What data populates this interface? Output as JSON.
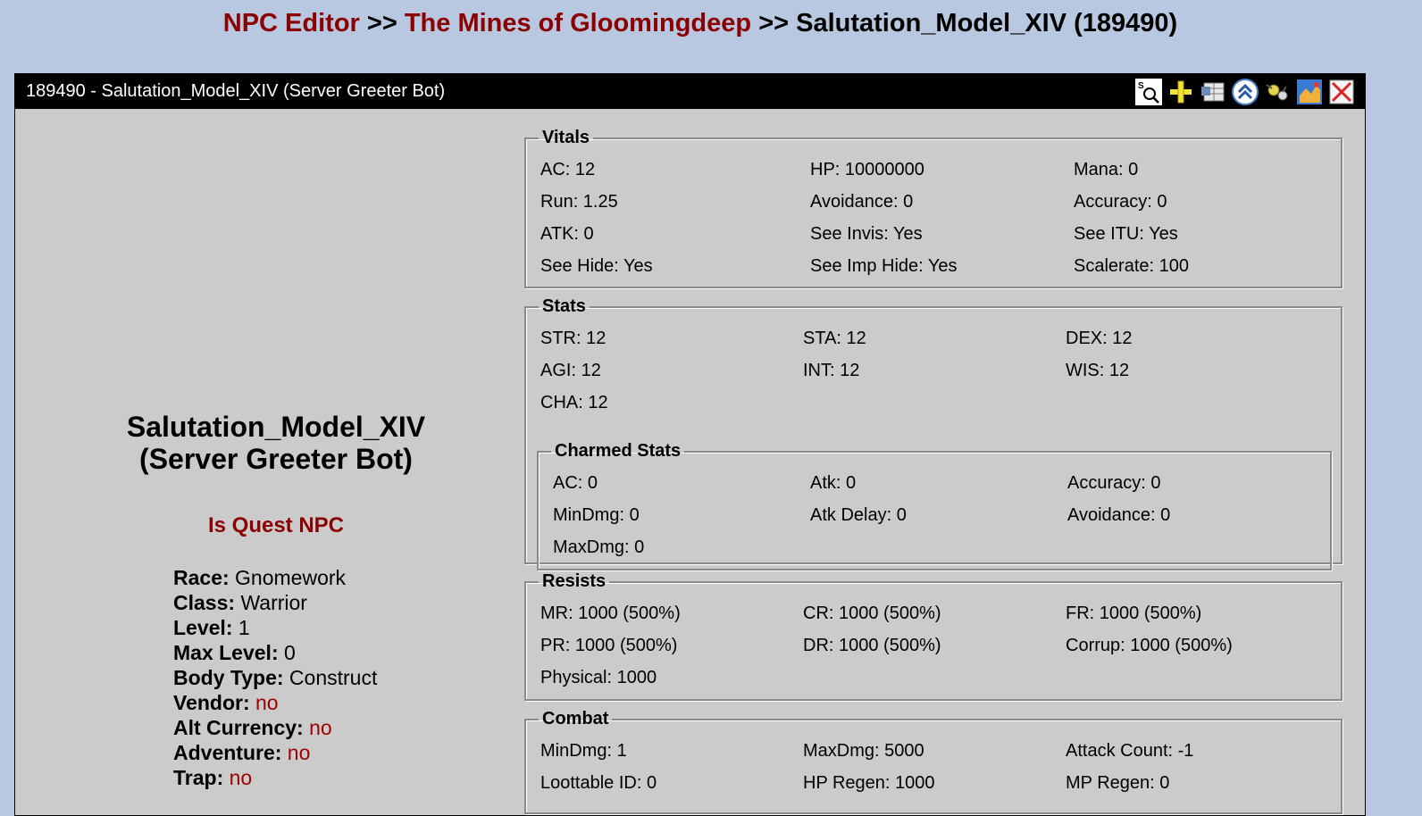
{
  "breadcrumb": {
    "root": "NPC Editor",
    "sep1": ">>",
    "zone": "The Mines of Gloomingdeep",
    "sep2": ">>",
    "current": "Salutation_Model_XIV (189490)"
  },
  "window": {
    "title": "189490 - Salutation_Model_XIV (Server Greeter Bot)",
    "toolbar_icons": [
      "search-icon",
      "add-icon",
      "table-icon",
      "up-arrow-icon",
      "bug-icon",
      "map-icon",
      "close-icon"
    ]
  },
  "npc": {
    "name_line1": "Salutation_Model_XIV",
    "name_line2": "(Server Greeter Bot)",
    "quest": "Is Quest NPC",
    "race_label": "Race:",
    "race": "Gnomework",
    "class_label": "Class:",
    "class": "Warrior",
    "level_label": "Level:",
    "level": "1",
    "maxlevel_label": "Max Level:",
    "maxlevel": "0",
    "bodytype_label": "Body Type:",
    "bodytype": "Construct",
    "vendor_label": "Vendor:",
    "vendor": "no",
    "altcur_label": "Alt Currency:",
    "altcur": "no",
    "adventure_label": "Adventure:",
    "adventure": "no",
    "trap_label": "Trap:",
    "trap": "no"
  },
  "vitals": {
    "legend": "Vitals",
    "cells": [
      "AC: 12",
      "HP: 10000000",
      "Mana: 0",
      "Run: 1.25",
      "Avoidance: 0",
      "Accuracy: 0",
      "ATK: 0",
      "See Invis: Yes",
      "See ITU: Yes",
      "See Hide: Yes",
      "See Imp Hide: Yes",
      "Scalerate: 100"
    ]
  },
  "stats": {
    "legend": "Stats",
    "cells": [
      "STR: 12",
      "STA: 12",
      "DEX: 12",
      "AGI: 12",
      "INT: 12",
      "WIS: 12",
      "CHA: 12"
    ]
  },
  "charmed": {
    "legend": "Charmed Stats",
    "cells": [
      "AC: 0",
      "Atk: 0",
      "Accuracy: 0",
      "MinDmg: 0",
      "Atk Delay: 0",
      "Avoidance: 0",
      "MaxDmg: 0"
    ]
  },
  "resists": {
    "legend": "Resists",
    "cells": [
      "MR: 1000 (500%)",
      "CR: 1000 (500%)",
      "FR: 1000 (500%)",
      "PR: 1000 (500%)",
      "DR: 1000 (500%)",
      "Corrup: 1000 (500%)",
      "Physical: 1000"
    ]
  },
  "combat": {
    "legend": "Combat",
    "cells": [
      "MinDmg: 1",
      "MaxDmg: 5000",
      "Attack Count: -1",
      "Loottable ID: 0",
      "HP Regen: 1000",
      "MP Regen: 0"
    ]
  }
}
